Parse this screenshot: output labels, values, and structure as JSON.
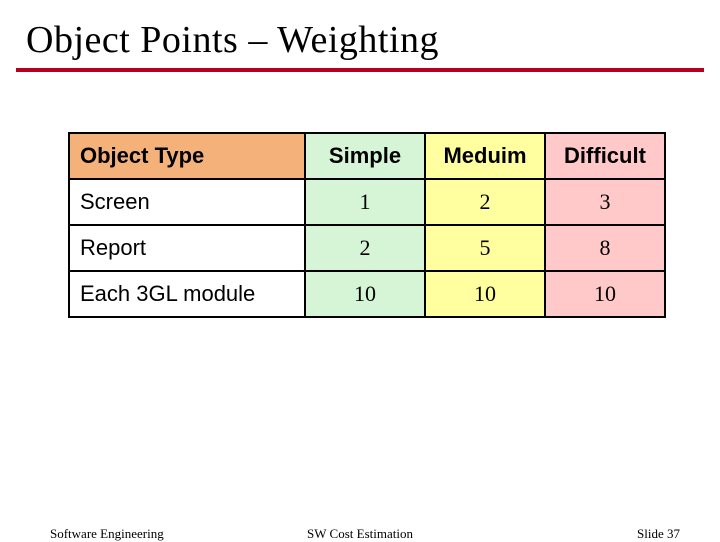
{
  "title": "Object Points – Weighting",
  "table": {
    "headers": [
      "Object Type",
      "Simple",
      "Meduim",
      "Difficult"
    ],
    "rows": [
      {
        "label": "Screen",
        "values": [
          1,
          2,
          3
        ]
      },
      {
        "label": "Report",
        "values": [
          2,
          5,
          8
        ]
      },
      {
        "label": "Each 3GL module",
        "values": [
          10,
          10,
          10
        ]
      }
    ]
  },
  "footer": {
    "left": "Software Engineering",
    "center": "SW Cost Estimation",
    "right": "Slide 37"
  },
  "chart_data": {
    "type": "table",
    "title": "Object Points – Weighting",
    "columns": [
      "Object Type",
      "Simple",
      "Meduim",
      "Difficult"
    ],
    "rows": [
      [
        "Screen",
        1,
        2,
        3
      ],
      [
        "Report",
        2,
        5,
        8
      ],
      [
        "Each 3GL module",
        10,
        10,
        10
      ]
    ]
  }
}
